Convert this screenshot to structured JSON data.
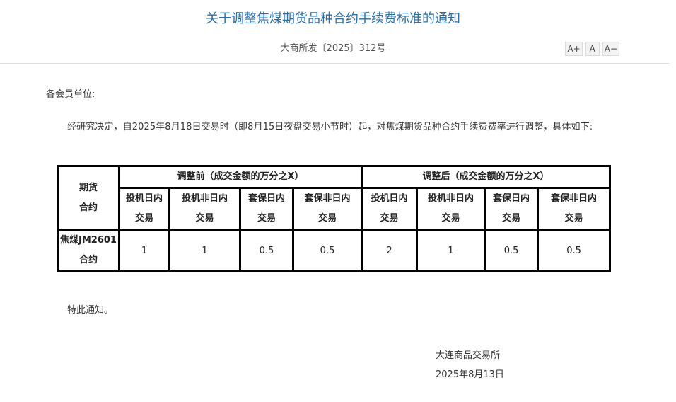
{
  "notice": {
    "title": "关于调整焦煤期货品种合约手续费标准的通知",
    "doc_number": "大商所发〔2025〕312号",
    "font_controls": {
      "increase": "A+",
      "normal": "A",
      "decrease": "A−"
    },
    "salutation": "各会员单位:",
    "body_paragraph": "经研究决定，自2025年8月18日交易时（即8月15日夜盘交易小节时）起，对焦煤期货品种合约手续费费率进行调整，具体如下:",
    "closing": "特此通知。",
    "signer": "大连商品交易所",
    "date": "2025年8月13日"
  },
  "table": {
    "corner_label_line1": "期货",
    "corner_label_line2": "合约",
    "group_before": "调整前（成交金额的万分之X）",
    "group_after": "调整后（成交金额的万分之X）",
    "columns": [
      {
        "line1": "投机日内",
        "line2": "交易"
      },
      {
        "line1": "投机非日内",
        "line2": "交易"
      },
      {
        "line1": "套保日内",
        "line2": "交易"
      },
      {
        "line1": "套保非日内",
        "line2": "交易"
      },
      {
        "line1": "投机日内",
        "line2": "交易"
      },
      {
        "line1": "投机非日内",
        "line2": "交易"
      },
      {
        "line1": "套保日内",
        "line2": "交易"
      },
      {
        "line1": "套保非日内",
        "line2": "交易"
      }
    ],
    "rows": [
      {
        "contract_line1": "焦煤JM2601",
        "contract_line2": "合约",
        "values": [
          "1",
          "1",
          "0.5",
          "0.5",
          "2",
          "1",
          "0.5",
          "0.5"
        ]
      }
    ]
  }
}
